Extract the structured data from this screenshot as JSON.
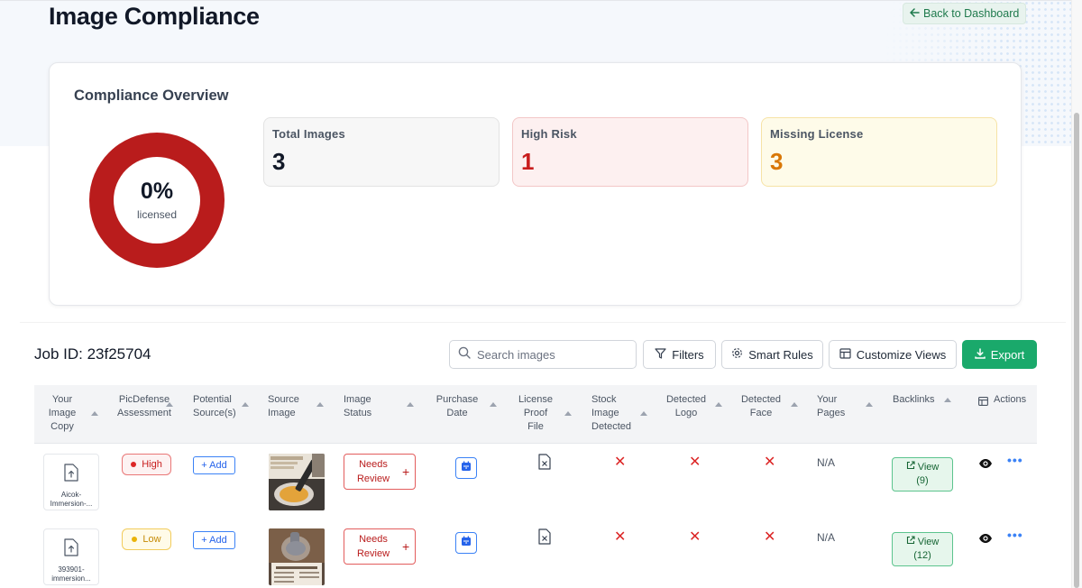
{
  "page": {
    "title": "Image Compliance",
    "back_label": "Back to Dashboard"
  },
  "overview": {
    "title": "Compliance Overview",
    "donut_value": "0%",
    "donut_label": "licensed",
    "licensed_fraction": 0,
    "stats": {
      "total": {
        "label": "Total Images",
        "value": "3"
      },
      "high": {
        "label": "High Risk",
        "value": "1"
      },
      "missing": {
        "label": "Missing License",
        "value": "3"
      }
    },
    "colors": {
      "donut": "#b91c1c",
      "high": "#c81e1e",
      "missing": "#d97706",
      "accent": "#1aa96b"
    }
  },
  "toolbar": {
    "job_id": "Job ID: 23f25704",
    "search_placeholder": "Search images",
    "filters_label": "Filters",
    "smart_rules_label": "Smart Rules",
    "customize_label": "Customize Views",
    "export_label": "Export"
  },
  "table": {
    "headers": {
      "copy": "Your Image Copy",
      "assessment": "PicDefense Assessment",
      "sources": "Potential Source(s)",
      "source_image": "Source Image",
      "status": "Image Status",
      "purchase": "Purchase Date",
      "license": "License Proof File",
      "stock": "Stock Image Detected",
      "logo": "Detected Logo",
      "face": "Detected Face",
      "pages": "Your Pages",
      "backlinks": "Backlinks",
      "actions": "Actions"
    },
    "rows": [
      {
        "file_name": "Aicok-Immersion-...",
        "assessment": "High",
        "add_label": "+ Add",
        "status": "Needs Review",
        "stock": "✕",
        "logo": "✕",
        "face": "✕",
        "pages": "N/A",
        "backlinks_label": "View",
        "backlinks_count": "(9)"
      },
      {
        "file_name": "393901-immersion...",
        "assessment": "Low",
        "add_label": "+ Add",
        "status": "Needs Review",
        "stock": "✕",
        "logo": "✕",
        "face": "✕",
        "pages": "N/A",
        "backlinks_label": "View",
        "backlinks_count": "(12)"
      }
    ]
  },
  "icons": [
    "arrow-left-icon",
    "search-icon",
    "filter-icon",
    "gear-icon",
    "table-icon",
    "download-icon",
    "upload-file-icon",
    "calendar-icon",
    "file-x-icon",
    "external-link-icon",
    "eye-icon",
    "more-icon",
    "plus-icon"
  ]
}
